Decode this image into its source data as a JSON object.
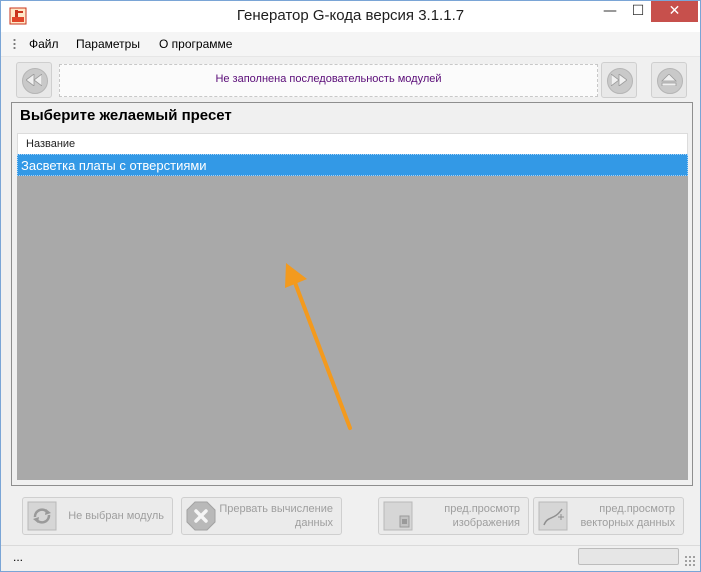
{
  "window": {
    "title": "Генератор G-кода версия 3.1.1.7",
    "close_symbol": "✕",
    "minimize_symbol": "—",
    "maximize_symbol": "☐",
    "icon": "app-machine-icon"
  },
  "menu": {
    "items": [
      {
        "label": "Файл"
      },
      {
        "label": "Параметры"
      },
      {
        "label": "О программе"
      }
    ]
  },
  "toolbar": {
    "back_icon": "rewind-icon",
    "sequence_text": "Не заполнена последовательность модулей",
    "forward_icon": "fast-forward-icon",
    "eject_icon": "eject-icon"
  },
  "preset_panel": {
    "title": "Выберите желаемый пресет",
    "column_header": "Название",
    "rows": [
      {
        "name": "Засветка платы с отверстиями",
        "selected": true
      }
    ]
  },
  "bottom_buttons": {
    "module": {
      "line1": "Не выбран модуль"
    },
    "abort": {
      "line1": "Прервать вычисление",
      "line2": "данных"
    },
    "preview_image": {
      "line1": "пред.просмотр",
      "line2": "изображения"
    },
    "preview_vector": {
      "line1": "пред.просмотр",
      "line2": "векторных данных"
    }
  },
  "statusbar": {
    "text": "..."
  },
  "colors": {
    "selection": "#3399e6",
    "list_background": "#a9a9a9",
    "arrow": "#f39a1e",
    "sequence_text": "#5a0c78",
    "close_button": "#c7504c"
  }
}
